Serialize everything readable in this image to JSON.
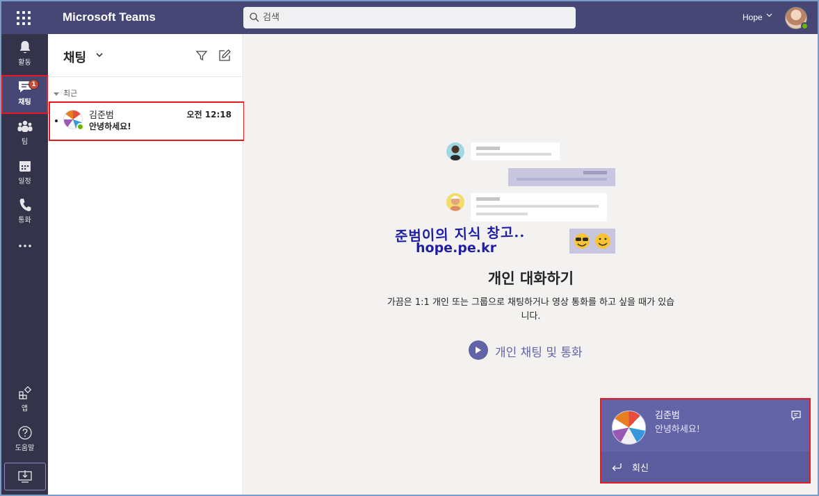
{
  "app": {
    "title": "Microsoft Teams",
    "search_placeholder": "검색",
    "user_name": "Hope"
  },
  "rail": {
    "items": [
      {
        "label": "활동",
        "icon": "bell-icon"
      },
      {
        "label": "채팅",
        "icon": "chat-icon",
        "badge": "1",
        "active": true
      },
      {
        "label": "팀",
        "icon": "teams-icon"
      },
      {
        "label": "일정",
        "icon": "calendar-icon"
      },
      {
        "label": "통화",
        "icon": "phone-icon"
      },
      {
        "label": "",
        "icon": "more-icon"
      },
      {
        "label": "앱",
        "icon": "apps-icon"
      },
      {
        "label": "도움말",
        "icon": "help-icon"
      }
    ]
  },
  "chatlist": {
    "title": "채팅",
    "section_label": "최근",
    "items": [
      {
        "name": "김준범",
        "time": "오전 12:18",
        "preview": "안녕하세요!",
        "unread": true,
        "presence": "available"
      }
    ]
  },
  "main": {
    "watermark_line1": "준범이의 지식 창고..",
    "watermark_line2": "hope.pe.kr",
    "heading": "개인 대화하기",
    "description": "가끔은 1:1 개인 또는 그룹으로 채팅하거나 영상 통화를 하고 싶을 때가 있습니다.",
    "link_label": "개인 채팅 및 통화"
  },
  "toast": {
    "name": "김준범",
    "message": "안녕하세요!",
    "reply_label": "회신"
  },
  "colors": {
    "brand": "#6264a7",
    "topbar": "#464775",
    "rail": "#33344a",
    "highlight": "#e8191f",
    "presence": "#6bb700"
  }
}
